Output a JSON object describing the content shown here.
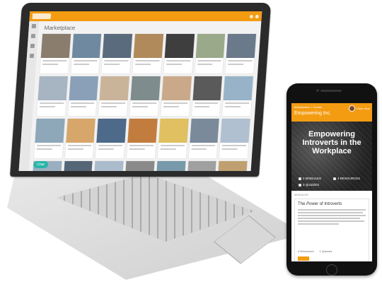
{
  "laptop": {
    "section_title": "Marketplace",
    "chat_label": "Chat",
    "card_colors": [
      "#8a7d6e",
      "#6f8aa0",
      "#5b6b7e",
      "#b08a5a",
      "#3e3e3e",
      "#9aa98a",
      "#6a7a8a",
      "#a7b4c2",
      "#8aa0b8",
      "#c9b49a",
      "#7f8c8d",
      "#c9a98a",
      "#5a5a5a",
      "#98b3c8",
      "#8ea7b9",
      "#d7a66a",
      "#4d6a8a",
      "#c27d3e",
      "#e0c060",
      "#7a8a9a",
      "#b0c0d0",
      "#9ab0c0",
      "#556677",
      "#aabbcc",
      "#8a8a8a",
      "#7799aa",
      "#a0a0a0",
      "#c0a070"
    ]
  },
  "phone": {
    "breadcrumb": "Marketplace  >  Course",
    "app_title": "Empowering Inc.",
    "user_name": "Chris Jane",
    "hero_title": "Empowering Introverts in the Workplace",
    "stats": [
      {
        "icon": "folder-icon",
        "label": "2 MODULES"
      },
      {
        "icon": "book-icon",
        "label": "4 RESOURCES"
      },
      {
        "icon": "quiz-icon",
        "label": "3 QUIZZES"
      }
    ],
    "modules_label": "MODULES",
    "module_title_prefix": "The ",
    "module_title_em": "Power",
    "module_title_suffix": " of Introverts",
    "module_resources": "4 Resources",
    "module_quizzes": "1 Quizzes"
  },
  "colors": {
    "accent": "#f39c12",
    "chat": "#2bb5a8"
  }
}
